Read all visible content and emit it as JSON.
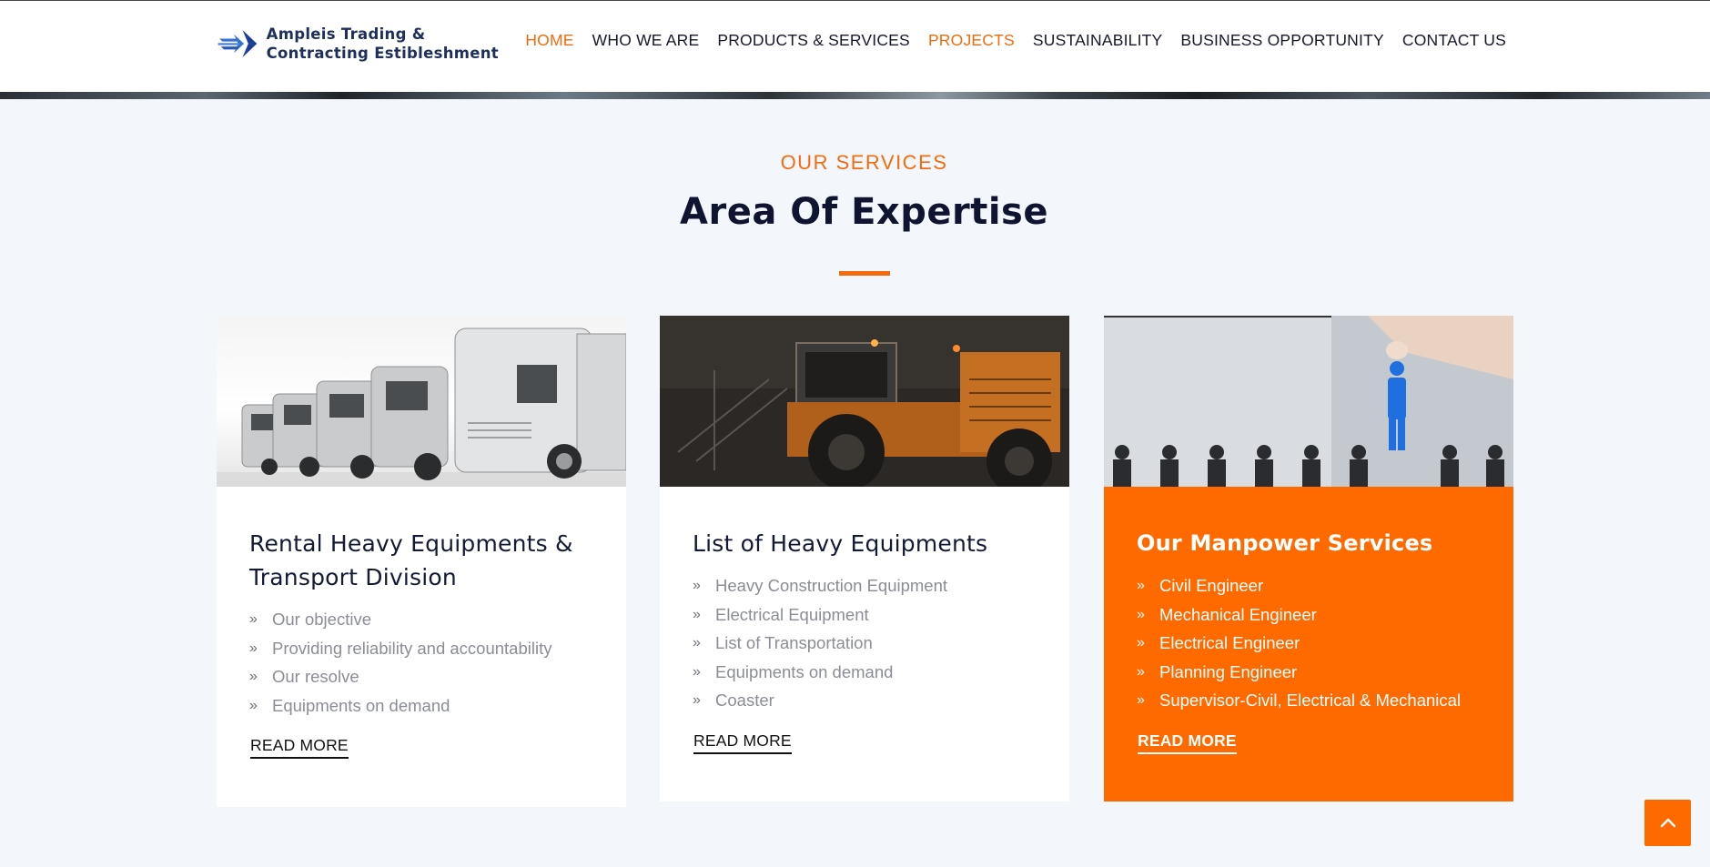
{
  "header": {
    "logo_line1": "Ampleis  Trading  &",
    "logo_line2": "Contracting  Estibleshment",
    "nav": [
      {
        "label": "HOME",
        "active": true
      },
      {
        "label": "WHO WE ARE",
        "active": false
      },
      {
        "label": "PRODUCTS & SERVICES",
        "active": false
      },
      {
        "label": "PROJECTS",
        "active": true
      },
      {
        "label": "SUSTAINABILITY",
        "active": false
      },
      {
        "label": "BUSINESS OPPORTUNITY",
        "active": false
      },
      {
        "label": "CONTACT US",
        "active": false
      }
    ]
  },
  "section": {
    "eyebrow": "OUR SERVICES",
    "title": "Area Of Expertise"
  },
  "cards": [
    {
      "title": "Rental Heavy Equipments & Transport Division",
      "image": "white-trucks-fleet",
      "items": [
        "Our objective",
        "Providing reliability and accountability",
        "Our resolve",
        "Equipments on demand"
      ],
      "read_more": "READ MORE"
    },
    {
      "title": "List of Heavy Equipments",
      "image": "heavy-loader-at-dusk",
      "items": [
        "Heavy Construction Equipment",
        "Electrical Equipment",
        "List of Transportation",
        "Equipments on demand",
        "Coaster"
      ],
      "read_more": "READ MORE"
    },
    {
      "title": "Our Manpower Services",
      "image": "hand-selecting-person",
      "items": [
        "Civil Engineer",
        "Mechanical Engineer",
        "Electrical Engineer",
        "Planning Engineer",
        "Supervisor-Civil, Electrical & Mechanical"
      ],
      "read_more": "READ MORE"
    }
  ],
  "colors": {
    "accent": "#ff6a00",
    "heading": "#0f1530",
    "muted_text": "#8a8d95"
  },
  "icons": {
    "bullet": "double-chevron-right-icon",
    "back_to_top": "chevron-up-icon"
  }
}
